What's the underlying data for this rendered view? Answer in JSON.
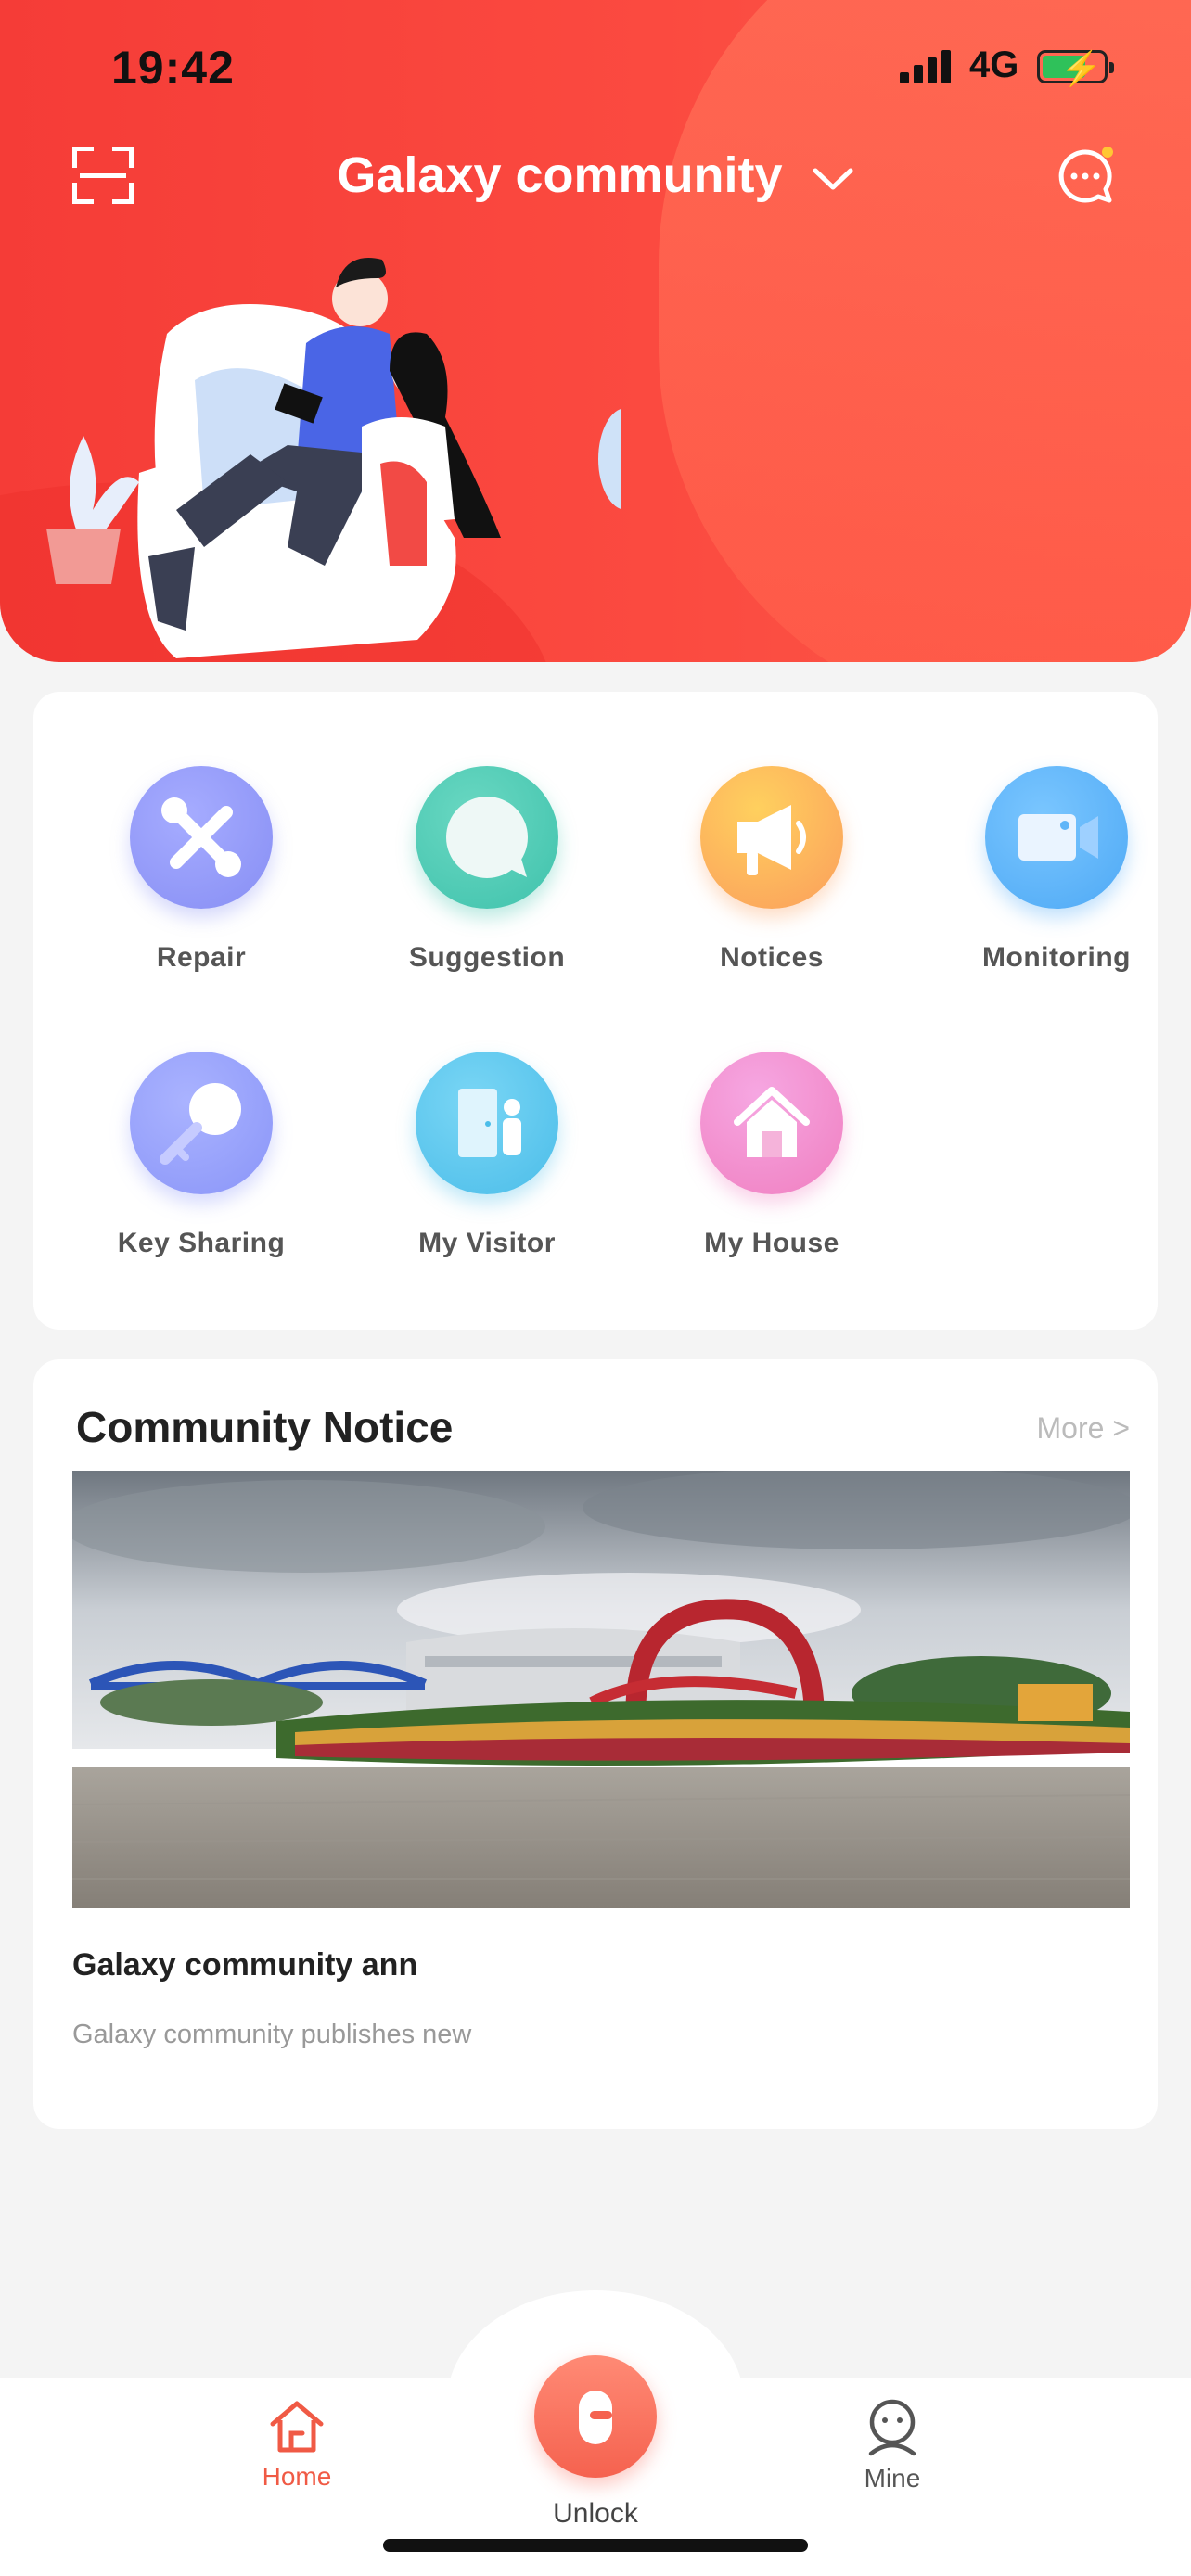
{
  "status_bar": {
    "time": "19:42",
    "network": "4G"
  },
  "header": {
    "community_name": "Galaxy community"
  },
  "features": [
    {
      "label": "Repair",
      "icon": "wrench-screwdriver-icon",
      "color": "#8f96f7"
    },
    {
      "label": "Suggestion",
      "icon": "chat-bubble-icon",
      "color": "#4ccbb4"
    },
    {
      "label": "Notices",
      "icon": "megaphone-icon",
      "color": "#fcae59"
    },
    {
      "label": "Monitoring",
      "icon": "video-camera-icon",
      "color": "#5fb5f8"
    },
    {
      "label": "Key Sharing",
      "icon": "key-icon",
      "color": "#8f9af9"
    },
    {
      "label": "My Visitor",
      "icon": "visitor-door-icon",
      "color": "#5ec7ef"
    },
    {
      "label": "My House",
      "icon": "house-icon",
      "color": "#f493d1"
    }
  ],
  "community_notice": {
    "title": "Community Notice",
    "more": "More >",
    "announcement_title": "Galaxy community ann",
    "announcement_summary": "Galaxy community publishes new"
  },
  "tab_bar": {
    "home": "Home",
    "unlock": "Unlock",
    "mine": "Mine",
    "active_color": "#f05a45"
  }
}
